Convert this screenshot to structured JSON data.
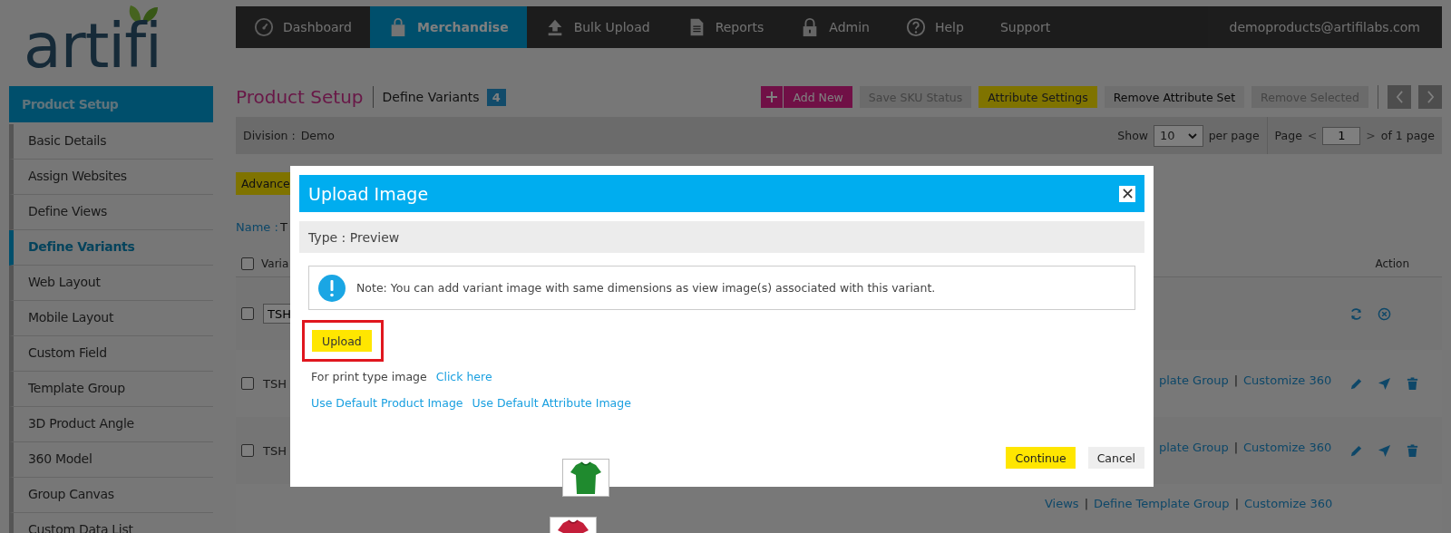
{
  "logo": {
    "text": "artifi"
  },
  "nav": {
    "items": [
      {
        "label": "Dashboard",
        "selected": false
      },
      {
        "label": "Merchandise",
        "selected": true
      },
      {
        "label": "Bulk Upload",
        "selected": false
      },
      {
        "label": "Reports",
        "selected": false
      },
      {
        "label": "Admin",
        "selected": false
      },
      {
        "label": "Help",
        "selected": false
      },
      {
        "label": "Support",
        "selected": false
      }
    ],
    "user": "demoproducts@artifilabs.com"
  },
  "sidebar": {
    "title": "Product Setup",
    "items": [
      {
        "label": "Basic Details",
        "selected": false
      },
      {
        "label": "Assign Websites",
        "selected": false
      },
      {
        "label": "Define Views",
        "selected": false
      },
      {
        "label": "Define Variants",
        "selected": true
      },
      {
        "label": "Web Layout",
        "selected": false
      },
      {
        "label": "Mobile Layout",
        "selected": false
      },
      {
        "label": "Custom Field",
        "selected": false
      },
      {
        "label": "Template Group",
        "selected": false
      },
      {
        "label": "3D Product Angle",
        "selected": false
      },
      {
        "label": "360 Model",
        "selected": false
      },
      {
        "label": "Group Canvas",
        "selected": false
      },
      {
        "label": "Custom Data List",
        "selected": false
      }
    ]
  },
  "page": {
    "title": "Product Setup",
    "subtitle": "Define Variants",
    "count": "4"
  },
  "toolbar": {
    "buttons": [
      {
        "label": "Add New",
        "kind": "add"
      },
      {
        "label": "Save SKU Status",
        "kind": "disabled"
      },
      {
        "label": "Attribute Settings",
        "kind": "highlight"
      },
      {
        "label": "Remove Attribute Set",
        "kind": "plain"
      },
      {
        "label": "Remove Selected",
        "kind": "disabled"
      }
    ]
  },
  "filter": {
    "division_label": "Division :",
    "division": "Demo",
    "show_label": "Show",
    "per_page": "10",
    "per_page_label": "per page",
    "page_label": "Page",
    "prev": "<",
    "page": "1",
    "next": ">",
    "of_pages": "of 1 page"
  },
  "advanced_button": "Advance",
  "name": {
    "label": "Name :",
    "value": "T"
  },
  "table": {
    "header": {
      "checked": false,
      "column_1": "Varia",
      "action": "Action"
    },
    "rows": [
      {
        "kind": "editing",
        "checked": false,
        "sku": "TSH"
      },
      {
        "kind": "saved",
        "checked": false,
        "sku": "TSH",
        "links": [
          {
            "kind": "link",
            "text": "plate Group"
          },
          {
            "kind": "separator",
            "text": "|"
          },
          {
            "kind": "link",
            "text": "Customize 360"
          }
        ]
      },
      {
        "kind": "saved",
        "checked": false,
        "sku": "TSH",
        "thumbnail": {
          "kind": "picture"
        },
        "links": [
          {
            "kind": "link",
            "text": "plate Group"
          },
          {
            "kind": "separator",
            "text": "|"
          },
          {
            "kind": "link",
            "text": "Customize 360"
          }
        ]
      },
      {
        "kind": "partial",
        "thumbnail": {
          "kind": "picture"
        },
        "links": [
          {
            "kind": "link",
            "text": "Views"
          },
          {
            "kind": "separator",
            "text": "|"
          },
          {
            "kind": "link",
            "text": "Define Template Group"
          },
          {
            "kind": "separator",
            "text": "|"
          },
          {
            "kind": "link",
            "text": "Customize 360"
          }
        ]
      }
    ]
  },
  "modal": {
    "title": "Upload Image",
    "type_label": "Type : Preview",
    "note": "Note: You can add variant image with same dimensions as view image(s) associated with this variant.",
    "upload": {
      "label": "Upload",
      "highlighted": true
    },
    "print_text": "For print type image",
    "print_link": "Click here",
    "links": [
      "Use Default Product Image",
      "Use Default Attribute Image"
    ],
    "buttons": [
      {
        "label": "Continue",
        "kind": "primary"
      },
      {
        "label": "Cancel",
        "kind": "secondary"
      }
    ]
  }
}
